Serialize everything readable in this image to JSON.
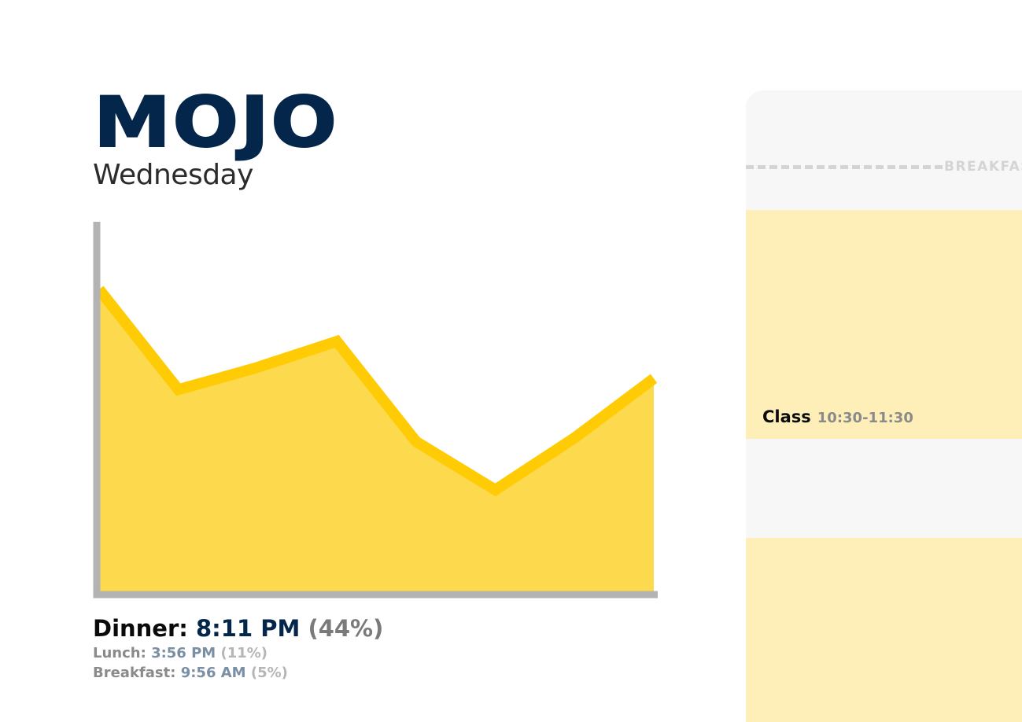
{
  "app": {
    "logo": "MOJO",
    "day": "Wednesday"
  },
  "chart_data": {
    "type": "area",
    "x": [
      0,
      1,
      2,
      3,
      4,
      5,
      6,
      7
    ],
    "values": [
      0.82,
      0.55,
      0.61,
      0.68,
      0.41,
      0.28,
      0.42,
      0.58
    ],
    "ylim": [
      0,
      1
    ],
    "colors": {
      "fill": "#fdd94e",
      "line": "#fecb05",
      "axis": "#b3b3b3"
    }
  },
  "stats": {
    "dinner": {
      "label": "Dinner:",
      "time": "8:11 PM",
      "percent": "(44%)"
    },
    "lunch": {
      "label": "Lunch:",
      "time": "3:56 PM",
      "percent": "(11%)"
    },
    "breakfast": {
      "label": "Breakfast:",
      "time": "9:56 AM",
      "percent": "(5%)"
    }
  },
  "schedule": {
    "marker_label": "BREAKFAST",
    "events": [
      {
        "title": "Class",
        "time": "10:30-11:30"
      }
    ]
  },
  "colors": {
    "brand": "#04264a",
    "accent": "#fecb05",
    "event_bg": "#feefb9",
    "panel_bg": "#f7f7f7"
  }
}
